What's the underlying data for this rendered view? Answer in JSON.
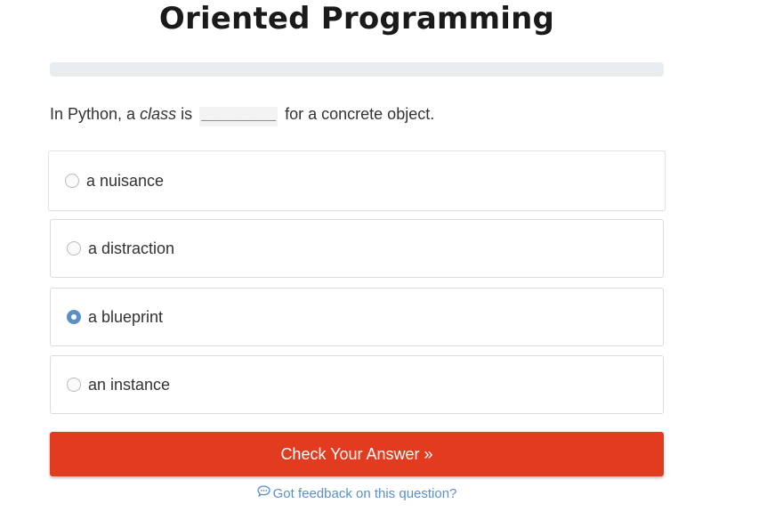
{
  "header": {
    "title": "Oriented Programming"
  },
  "progress": {
    "value": 0
  },
  "question": {
    "prefix": "In Python, a ",
    "emphasis": "class",
    "middle": " is ",
    "blank": "__________",
    "suffix": " for a concrete object."
  },
  "options": [
    {
      "label": "a nuisance",
      "selected": false
    },
    {
      "label": "a distraction",
      "selected": false
    },
    {
      "label": "a blueprint",
      "selected": true
    },
    {
      "label": "an instance",
      "selected": false
    }
  ],
  "actions": {
    "check_label": "Check Your Answer »",
    "feedback_label": "Got feedback on this question?"
  },
  "icons": {
    "feedback": "speech-bubble-icon"
  },
  "colors": {
    "accent": "#e33b1f",
    "link": "#5b8fc7",
    "selected_radio": "#5b8fc7"
  }
}
